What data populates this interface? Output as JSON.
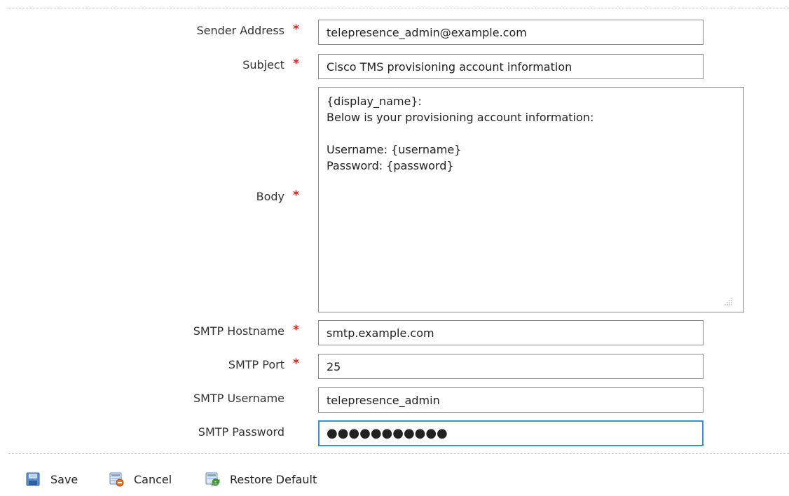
{
  "form": {
    "sender_address": {
      "label": "Sender Address",
      "required_mark": "*",
      "value": "telepresence_admin@example.com"
    },
    "subject": {
      "label": "Subject",
      "required_mark": "*",
      "value": "Cisco TMS provisioning account information"
    },
    "body": {
      "label": "Body",
      "required_mark": "*",
      "value": "{display_name}:\nBelow is your provisioning account information:\n\nUsername: {username}\nPassword: {password}"
    },
    "smtp_hostname": {
      "label": "SMTP Hostname",
      "required_mark": "*",
      "value": "smtp.example.com"
    },
    "smtp_port": {
      "label": "SMTP Port",
      "required_mark": "*",
      "value": "25"
    },
    "smtp_username": {
      "label": "SMTP Username",
      "value": "telepresence_admin"
    },
    "smtp_password": {
      "label": "SMTP Password",
      "value": "●●●●●●●●●●●"
    }
  },
  "toolbar": {
    "save_label": "Save",
    "cancel_label": "Cancel",
    "restore_label": "Restore Default"
  },
  "colors": {
    "required": "#d9261c",
    "focus_border": "#3a8fd6",
    "field_border": "#8a8a8a",
    "divider": "#c8c8c8"
  },
  "icons": {
    "save": "save-icon",
    "cancel": "cancel-icon",
    "restore": "restore-default-icon"
  }
}
